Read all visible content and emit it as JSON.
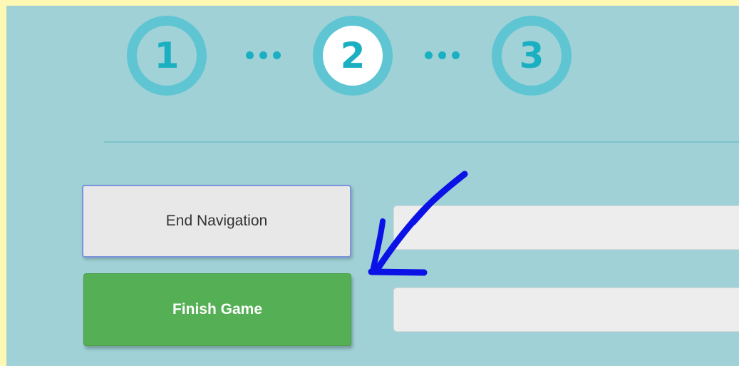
{
  "stepper": {
    "steps": [
      {
        "label": "1",
        "active": false
      },
      {
        "label": "2",
        "active": true
      },
      {
        "label": "3",
        "active": false
      }
    ],
    "current_step": 2
  },
  "buttons": {
    "end_navigation": "End Navigation",
    "finish_game": "Finish Game"
  },
  "fields": {
    "field_1": {
      "value": "",
      "placeholder": ""
    },
    "field_2": {
      "value": "",
      "placeholder": ""
    }
  },
  "annotation": {
    "icon": "hand-drawn-arrow-icon",
    "color": "#0a12e6"
  },
  "colors": {
    "page_border": "#fdf9b4",
    "background": "#9fd1d6",
    "step_ring": "#5fc5d3",
    "step_number": "#1ab0c2",
    "finish_button": "#55b055",
    "end_button": "#e8e8e9"
  }
}
